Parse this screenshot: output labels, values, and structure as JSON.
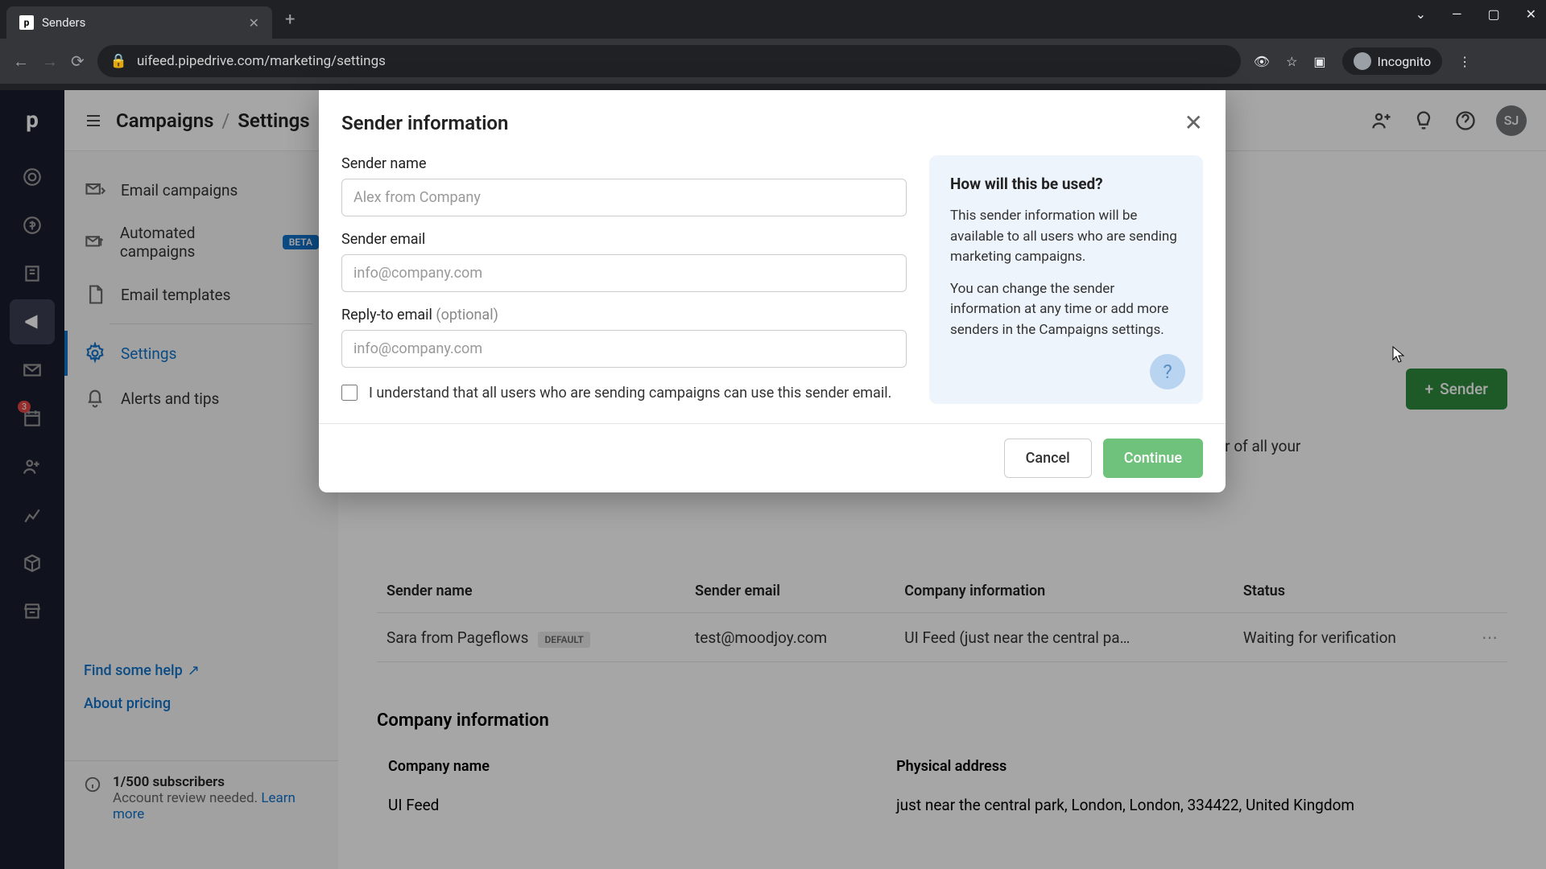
{
  "browser": {
    "tab_title": "Senders",
    "url": "uifeed.pipedrive.com/marketing/settings",
    "incognito_label": "Incognito"
  },
  "topbar": {
    "breadcrumb_root": "Campaigns",
    "breadcrumb_current": "Settings",
    "avatar_initials": "SJ"
  },
  "side_nav": {
    "items": [
      {
        "label": "Email campaigns"
      },
      {
        "label": "Automated campaigns",
        "badge": "BETA"
      },
      {
        "label": "Email templates"
      },
      {
        "label": "Settings"
      },
      {
        "label": "Alerts and tips"
      }
    ],
    "help_link": "Find some help",
    "about_link": "About pricing",
    "sub_title": "1/500 subscribers",
    "sub_desc": "Account review needed.",
    "sub_learn": "Learn more"
  },
  "rail": {
    "badge": "3"
  },
  "page": {
    "sender_button": "Sender",
    "footer_text_fragment": "sed in the footer of all your",
    "table": {
      "headers": [
        "Sender name",
        "Sender email",
        "Company information",
        "Status"
      ],
      "row": {
        "name": "Sara from Pageflows",
        "default_badge": "DEFAULT",
        "email": "test@moodjoy.com",
        "company": "UI Feed (just near the central pa…",
        "status": "Waiting for verification"
      }
    },
    "section2_title": "Company information",
    "company_table": {
      "headers": [
        "Company name",
        "Physical address"
      ],
      "row": {
        "name": "UI Feed",
        "address": "just near the central park, London, London, 334422, United Kingdom"
      }
    }
  },
  "modal": {
    "title": "Sender information",
    "fields": {
      "name_label": "Sender name",
      "name_placeholder": "Alex from Company",
      "email_label": "Sender email",
      "email_placeholder": "info@company.com",
      "reply_label": "Reply-to email",
      "reply_optional": "(optional)",
      "reply_placeholder": "info@company.com",
      "checkbox_label": "I understand that all users who are sending campaigns can use this sender email."
    },
    "info": {
      "title": "How will this be used?",
      "p1": "This sender information will be available to all users who are sending marketing campaigns.",
      "p2": "You can change the sender information at any time or add more senders in the Campaigns settings."
    },
    "buttons": {
      "cancel": "Cancel",
      "continue": "Continue"
    }
  }
}
